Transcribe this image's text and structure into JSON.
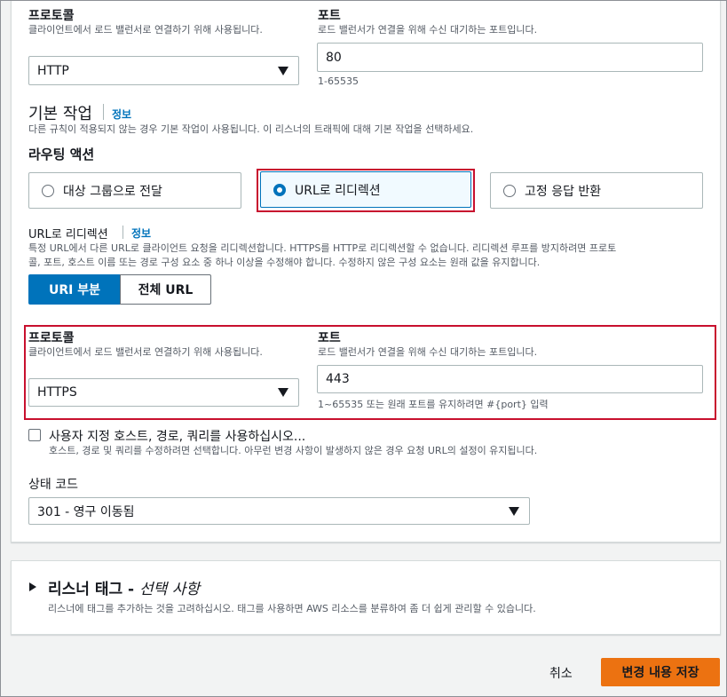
{
  "top": {
    "protocol_label": "프로토콜",
    "protocol_desc": "클라이언트에서 로드 밸런서로 연결하기 위해 사용됩니다.",
    "protocol_value": "HTTP",
    "port_label": "포트",
    "port_desc": "로드 밸런서가 연결을 위해 수신 대기하는 포트입니다.",
    "port_value": "80",
    "port_hint": "1-65535"
  },
  "default_action": {
    "title": "기본 작업",
    "info": "정보",
    "desc": "다른 규칙이 적용되지 않는 경우 기본 작업이 사용됩니다. 이 리스너의 트래픽에 대해 기본 작업을 선택하세요.",
    "routing_label": "라우팅 액션",
    "options": [
      {
        "label": "대상 그룹으로 전달",
        "selected": false
      },
      {
        "label": "URL로 리디렉션",
        "selected": true
      },
      {
        "label": "고정 응답 반환",
        "selected": false
      }
    ]
  },
  "redirect": {
    "title": "URL로 리디렉션",
    "info": "정보",
    "desc_line1": "특정 URL에서 다른 URL로 클라이언트 요청을 리디렉션합니다. HTTPS를 HTTP로 리디렉션할 수 없습니다. 리디렉션 루프를 방지하려면 프로토",
    "desc_line2": "콜, 포트, 호스트 이름 또는 경로 구성 요소 중 하나 이상을 수정해야 합니다. 수정하지 않은 구성 요소는 원래 값을 유지합니다.",
    "seg_uri": "URI 부분",
    "seg_full": "전체 URL",
    "protocol_label": "프로토콜",
    "protocol_desc": "클라이언트에서 로드 밸런서로 연결하기 위해 사용됩니다.",
    "protocol_value": "HTTPS",
    "port_label": "포트",
    "port_desc": "로드 밸런서가 연결을 위해 수신 대기하는 포트입니다.",
    "port_value": "443",
    "port_hint": "1~65535 또는 원래 포트를 유지하려면 #{port} 입력",
    "custom_label": "사용자 지정 호스트, 경로, 쿼리를 사용하십시오...",
    "custom_desc": "호스트, 경로 및 쿼리를 수정하려면 선택합니다. 아무런 변경 사항이 발생하지 않은 경우 요청 URL의 설정이 유지됩니다.",
    "status_label": "상태 코드",
    "status_value": "301 - 영구 이동됨"
  },
  "tags": {
    "title": "리스너 태그 -",
    "optional": "선택 사항",
    "desc": "리스너에 태그를 추가하는 것을 고려하십시오. 태그를 사용하면 AWS 리소스를 분류하여 좀 더 쉽게 관리할 수 있습니다."
  },
  "footer": {
    "cancel": "취소",
    "save": "변경 내용 저장"
  }
}
